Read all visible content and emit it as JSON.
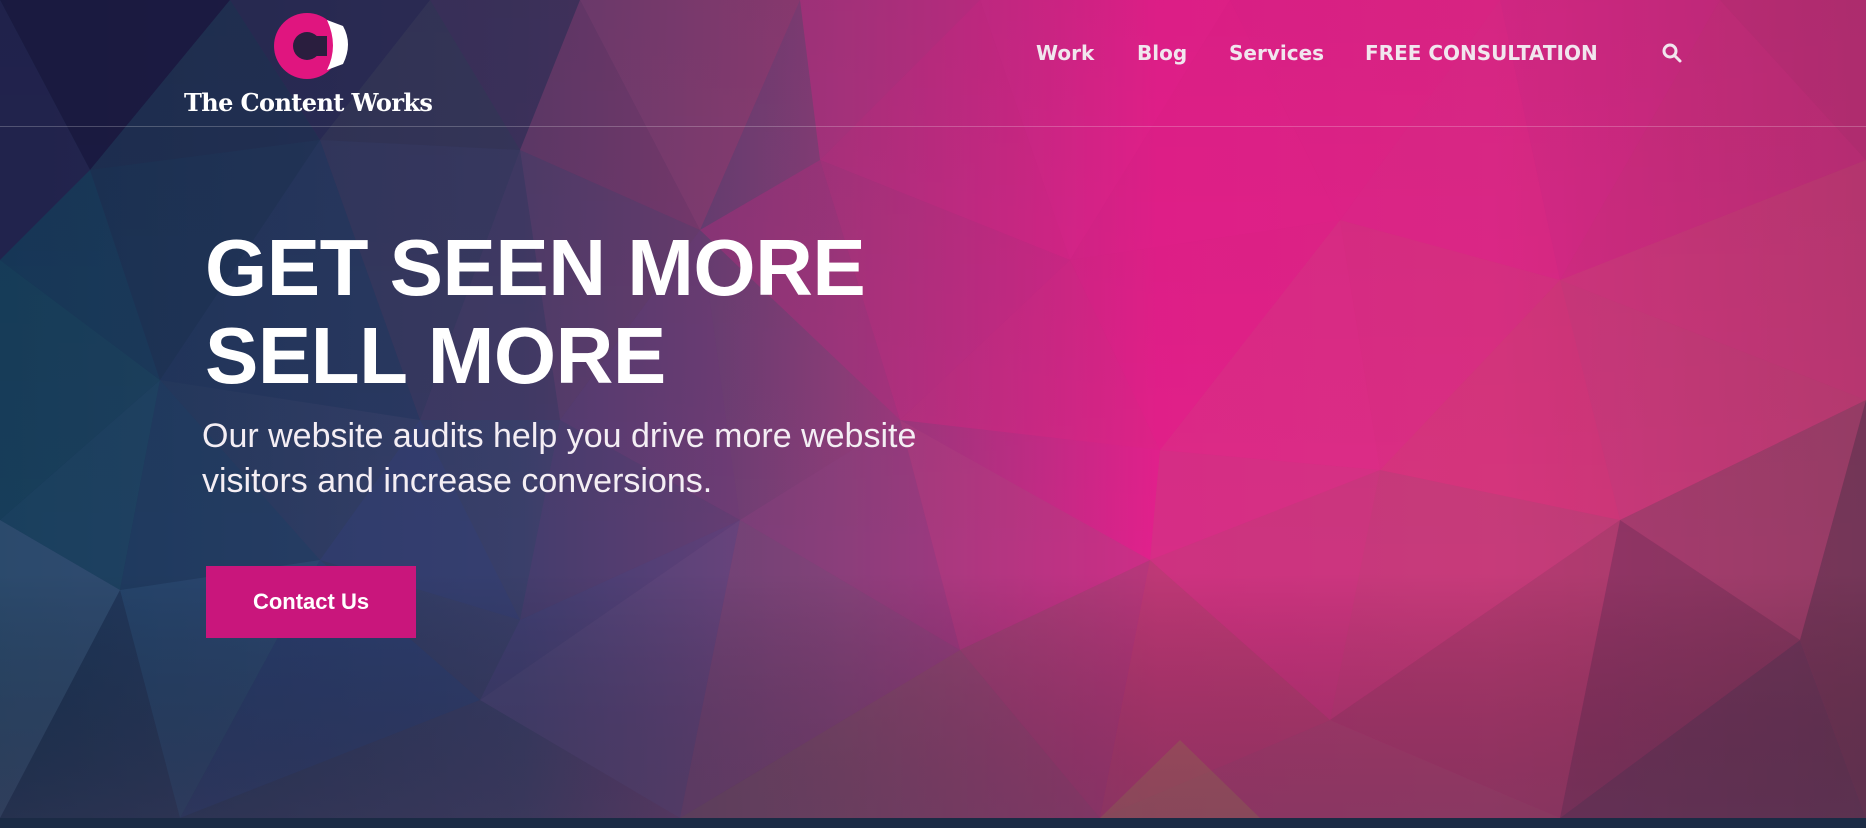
{
  "brand": {
    "name": "The Content Works",
    "accent_color": "#e0157f",
    "logo_icon": "c-logo-mark-icon"
  },
  "nav": {
    "items": [
      {
        "label": "Work"
      },
      {
        "label": "Blog"
      },
      {
        "label": "Services"
      },
      {
        "label": "FREE CONSULTATION"
      }
    ],
    "search_icon": "search-icon"
  },
  "hero": {
    "headline_line1": "GET SEEN MORE",
    "headline_line2": "SELL MORE",
    "subtext": "Our website audits help you drive more website visitors and increase conversions.",
    "cta_label": "Contact Us",
    "cta_color": "#c9167c"
  }
}
